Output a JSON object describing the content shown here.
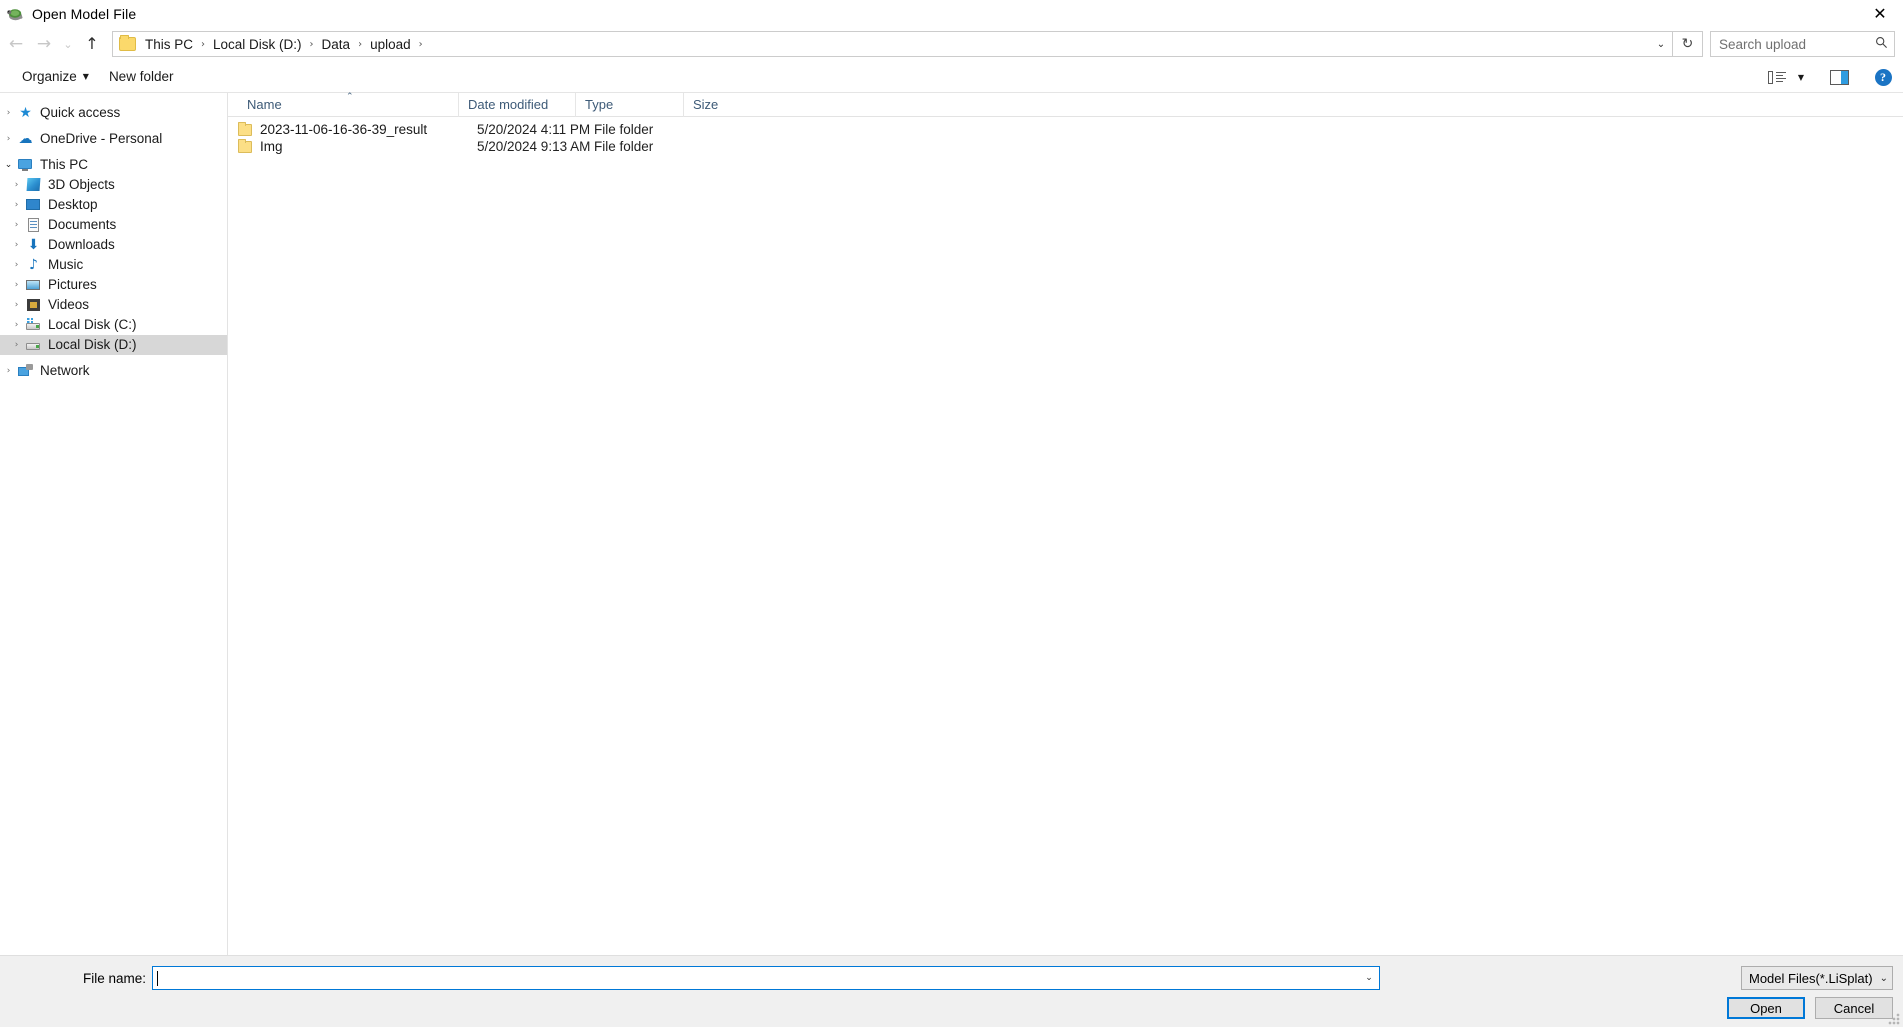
{
  "window": {
    "title": "Open Model File",
    "app_icon": "turtle-icon",
    "close_label": "✕"
  },
  "navbar": {
    "back_icon": "←",
    "forward_icon": "→",
    "history_icon": "⌄",
    "up_icon": "↑",
    "folder_icon": "folder-icon",
    "breadcrumbs": [
      {
        "label": "This PC"
      },
      {
        "label": "Local Disk (D:)"
      },
      {
        "label": "Data"
      },
      {
        "label": "upload"
      }
    ],
    "separator": "›",
    "dropdown_icon": "⌄",
    "refresh_icon": "↻",
    "search": {
      "placeholder": "Search upload",
      "value": "",
      "icon": "search-icon"
    }
  },
  "commandbar": {
    "organize_label": "Organize",
    "organize_caret": "▼",
    "new_folder_label": "New folder",
    "view_layout_icon": "view-layout-icon",
    "view_caret": "▼",
    "preview_pane_icon": "preview-pane-icon",
    "help_icon": "?"
  },
  "navpane": {
    "items": [
      {
        "label": "Quick access",
        "icon": "star-icon",
        "expander": "›",
        "indent": 0,
        "selected": false,
        "expanded": false
      },
      {
        "label": "OneDrive - Personal",
        "icon": "cloud-icon",
        "expander": "›",
        "indent": 0,
        "selected": false,
        "expanded": false
      },
      {
        "label": "This PC",
        "icon": "pc-icon",
        "expander": "⌄",
        "indent": 0,
        "selected": false,
        "expanded": true
      },
      {
        "label": "3D Objects",
        "icon": "3d-objects-icon",
        "expander": "›",
        "indent": 1,
        "selected": false,
        "expanded": false
      },
      {
        "label": "Desktop",
        "icon": "desktop-icon",
        "expander": "›",
        "indent": 1,
        "selected": false,
        "expanded": false
      },
      {
        "label": "Documents",
        "icon": "documents-icon",
        "expander": "›",
        "indent": 1,
        "selected": false,
        "expanded": false
      },
      {
        "label": "Downloads",
        "icon": "downloads-icon",
        "expander": "›",
        "indent": 1,
        "selected": false,
        "expanded": false
      },
      {
        "label": "Music",
        "icon": "music-icon",
        "expander": "›",
        "indent": 1,
        "selected": false,
        "expanded": false
      },
      {
        "label": "Pictures",
        "icon": "pictures-icon",
        "expander": "›",
        "indent": 1,
        "selected": false,
        "expanded": false
      },
      {
        "label": "Videos",
        "icon": "videos-icon",
        "expander": "›",
        "indent": 1,
        "selected": false,
        "expanded": false
      },
      {
        "label": "Local Disk (C:)",
        "icon": "disk-c-icon",
        "expander": "›",
        "indent": 1,
        "selected": false,
        "expanded": false
      },
      {
        "label": "Local Disk (D:)",
        "icon": "disk-d-icon",
        "expander": "›",
        "indent": 1,
        "selected": true,
        "expanded": false
      },
      {
        "label": "Network",
        "icon": "network-icon",
        "expander": "›",
        "indent": 0,
        "selected": false,
        "expanded": false
      }
    ]
  },
  "filelist": {
    "columns": [
      {
        "key": "name",
        "label": "Name",
        "sorted": true,
        "sort_arrow": "⌃"
      },
      {
        "key": "date",
        "label": "Date modified"
      },
      {
        "key": "type",
        "label": "Type"
      },
      {
        "key": "size",
        "label": "Size"
      }
    ],
    "rows": [
      {
        "icon": "folder-icon",
        "name": "2023-11-06-16-36-39_result",
        "date": "5/20/2024 4:11 PM",
        "type": "File folder",
        "size": ""
      },
      {
        "icon": "folder-icon",
        "name": "Img",
        "date": "5/20/2024 9:13 AM",
        "type": "File folder",
        "size": ""
      }
    ]
  },
  "footer": {
    "filename_label": "File name:",
    "filename_value": "",
    "filename_dropdown_icon": "⌄",
    "filter_value": "Model Files(*.LiSplat)",
    "filter_caret": "⌄",
    "open_label": "Open",
    "cancel_label": "Cancel"
  },
  "colors": {
    "accent": "#0078d7",
    "selection": "#d7d7d7",
    "header_text": "#3d5a77",
    "folder": "#fcdf86",
    "footer_bg": "#f0f0f0"
  }
}
